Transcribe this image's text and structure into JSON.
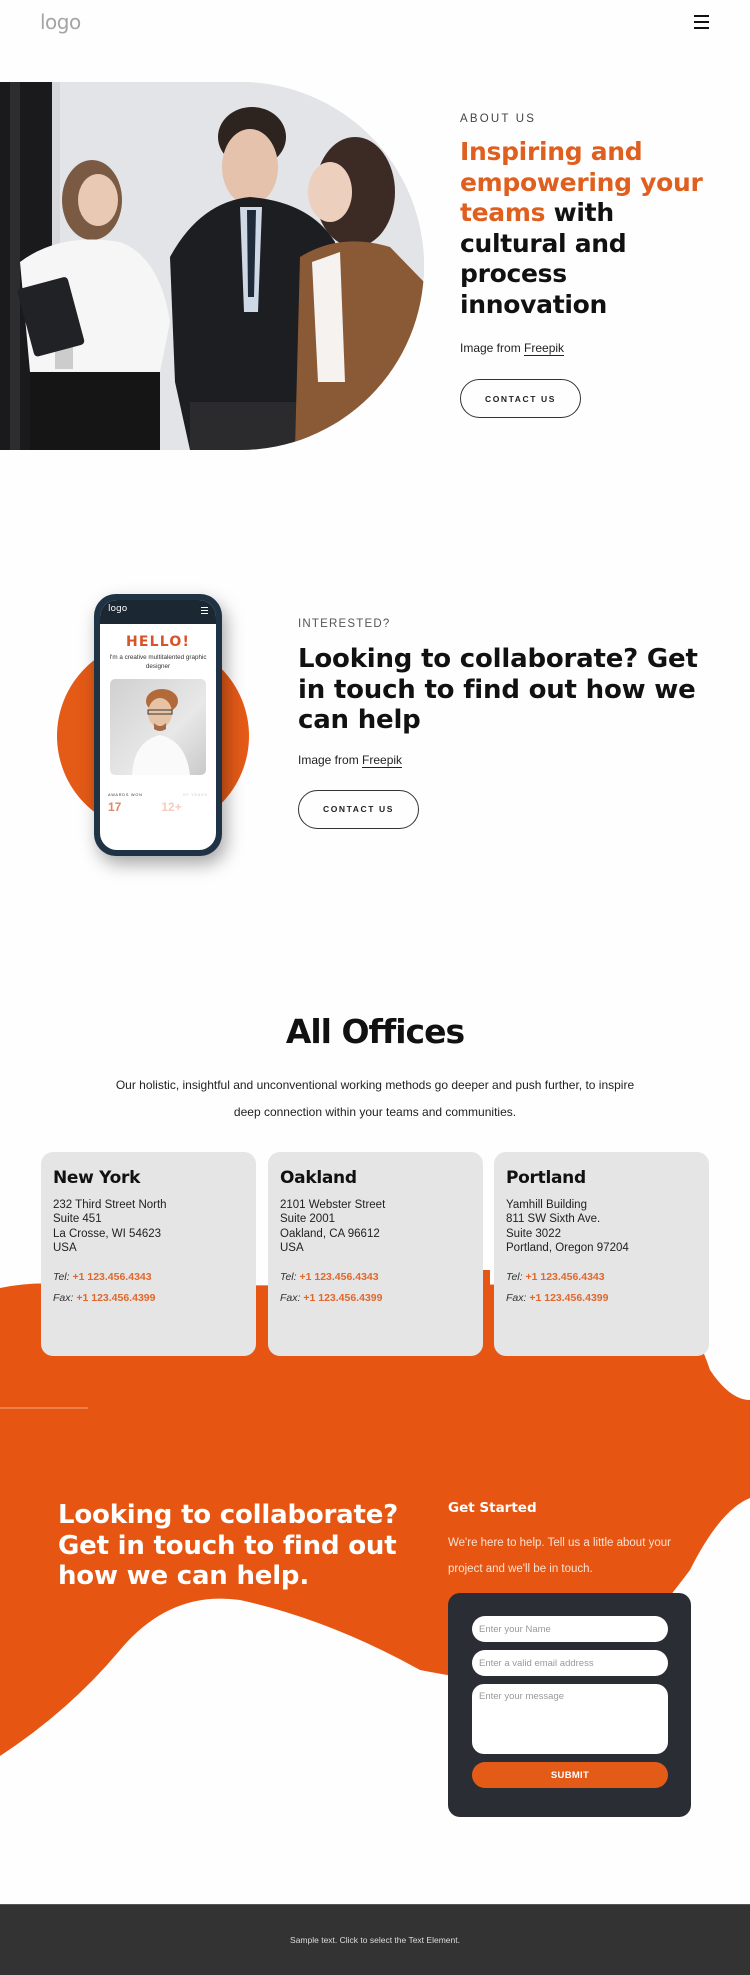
{
  "header": {
    "logo": "logo",
    "menu_icon": "hamburger-icon"
  },
  "hero": {
    "eyebrow": "ABOUT US",
    "title_accent": "Inspiring and empowering your teams",
    "title_rest": " with cultural and process innovation",
    "credit_prefix": "Image from ",
    "credit_link": "Freepik",
    "button": "CONTACT US",
    "image_alt": "three business colleagues talking in an office"
  },
  "collab": {
    "eyebrow": "INTERESTED?",
    "title": "Looking to collaborate? Get in touch to find out how we can help",
    "credit_prefix": "Image from ",
    "credit_link": "Freepik",
    "button": "CONTACT US",
    "phone": {
      "logo": "logo",
      "hello": "HELLO!",
      "subtitle": "I'm a creative multitalented graphic designer",
      "stat1_label": "AWARDS WON",
      "stat2_label": "XP YEARS",
      "stat1_value": "17",
      "stat2_value": "12+"
    }
  },
  "offices": {
    "title": "All Offices",
    "description": "Our holistic, insightful and unconventional working methods go deeper and push further, to inspire deep connection within your teams and communities.",
    "tel_label": "Tel:",
    "fax_label": "Fax:",
    "cards": [
      {
        "city": "New York",
        "address": [
          "232 Third Street North",
          "Suite 451",
          "La Crosse, WI 54623",
          "USA"
        ],
        "tel": "+1 123.456.4343",
        "fax": "+1 123.456.4399"
      },
      {
        "city": "Oakland",
        "address": [
          "2101 Webster Street",
          "Suite 2001",
          "Oakland, CA 96612",
          "USA"
        ],
        "tel": "+1 123.456.4343",
        "fax": "+1 123.456.4399"
      },
      {
        "city": "Portland",
        "address": [
          "Yamhill Building",
          "811 SW Sixth Ave.",
          "Suite 3022",
          "Portland, Oregon 97204"
        ],
        "tel": "+1 123.456.4343",
        "fax": "+1 123.456.4399"
      }
    ]
  },
  "cta": {
    "title": "Looking to collaborate? Get in touch to find out how we can help.",
    "form_title": "Get Started",
    "form_desc": "We're here to help. Tell us a little about your project and we'll be in touch.",
    "name_placeholder": "Enter your Name",
    "email_placeholder": "Enter a valid email address",
    "message_placeholder": "Enter your message",
    "submit": "SUBMIT"
  },
  "footer": {
    "text": "Sample text. Click to select the Text Element."
  },
  "colors": {
    "accent": "#e45a17",
    "accent_text": "#df5f1f",
    "form_bg": "#2a2d33",
    "card_bg": "#e5e5e5",
    "footer_bg": "#333333"
  }
}
